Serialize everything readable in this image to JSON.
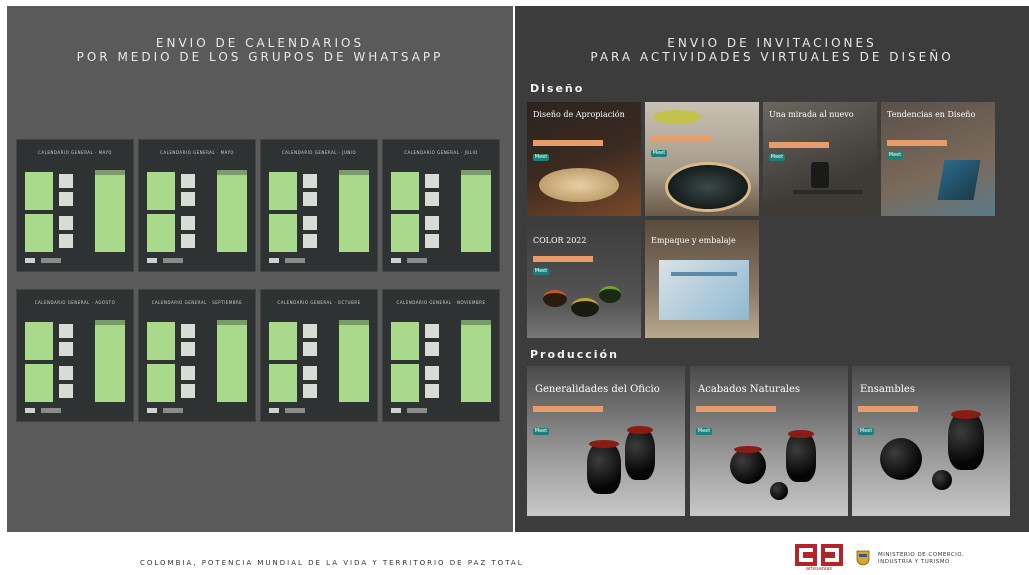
{
  "left": {
    "title_line1": "ENVIO DE CALENDARIOS",
    "title_line2": "POR MEDIO DE LOS GRUPOS DE WHATSAPP",
    "calendars": [
      {
        "title": "CALENDARIO GENERAL · MAYO"
      },
      {
        "title": "CALENDARIO GENERAL · MAYO"
      },
      {
        "title": "CALENDARIO GENERAL · JUNIO"
      },
      {
        "title": "CALENDARIO GENERAL · JULIO"
      },
      {
        "title": "CALENDARIO GENERAL · AGOSTO"
      },
      {
        "title": "CALENDARIO GENERAL · SEPTIEMBRE"
      },
      {
        "title": "CALENDARIO GENERAL · OCTUBRE"
      },
      {
        "title": "CALENDARIO GENERAL · NOVIEMBRE"
      }
    ]
  },
  "right": {
    "title_line1": "ENVIO DE INVITACIONES",
    "title_line2": "PARA ACTIVIDADES VIRTUALES DE DISEÑO",
    "section_design": "Diseño",
    "section_production": "Producción",
    "design_cards": [
      {
        "title": "Diseño de Apropiación"
      },
      {
        "title": ""
      },
      {
        "title": "Una mirada al nuevo"
      },
      {
        "title": "Tendencias en Diseño"
      },
      {
        "title": "COLOR 2022"
      },
      {
        "title": "Empaque y embalaje"
      }
    ],
    "production_cards": [
      {
        "title": "Generalidades del Oficio"
      },
      {
        "title": "Acabados Naturales"
      },
      {
        "title": "Ensambles"
      }
    ],
    "meet_label": "Meet"
  },
  "footer": {
    "slogan": "COLOMBIA, POTENCIA MUNDIAL DE LA VIDA Y TERRITORIO DE PAZ TOTAL",
    "logo_text": "artesanías",
    "ministry_line1": "MINISTERIO DE COMERCIO,",
    "ministry_line2": "INDUSTRIA Y TURISMO"
  },
  "colors": {
    "left_bg": "#5a5a5a",
    "right_bg": "#3c3c3c",
    "calendar_green": "#a9d98a",
    "accent_orange": "#e79c6a",
    "meet_teal": "#1e7f7a",
    "brand_red": "#b4232a"
  }
}
